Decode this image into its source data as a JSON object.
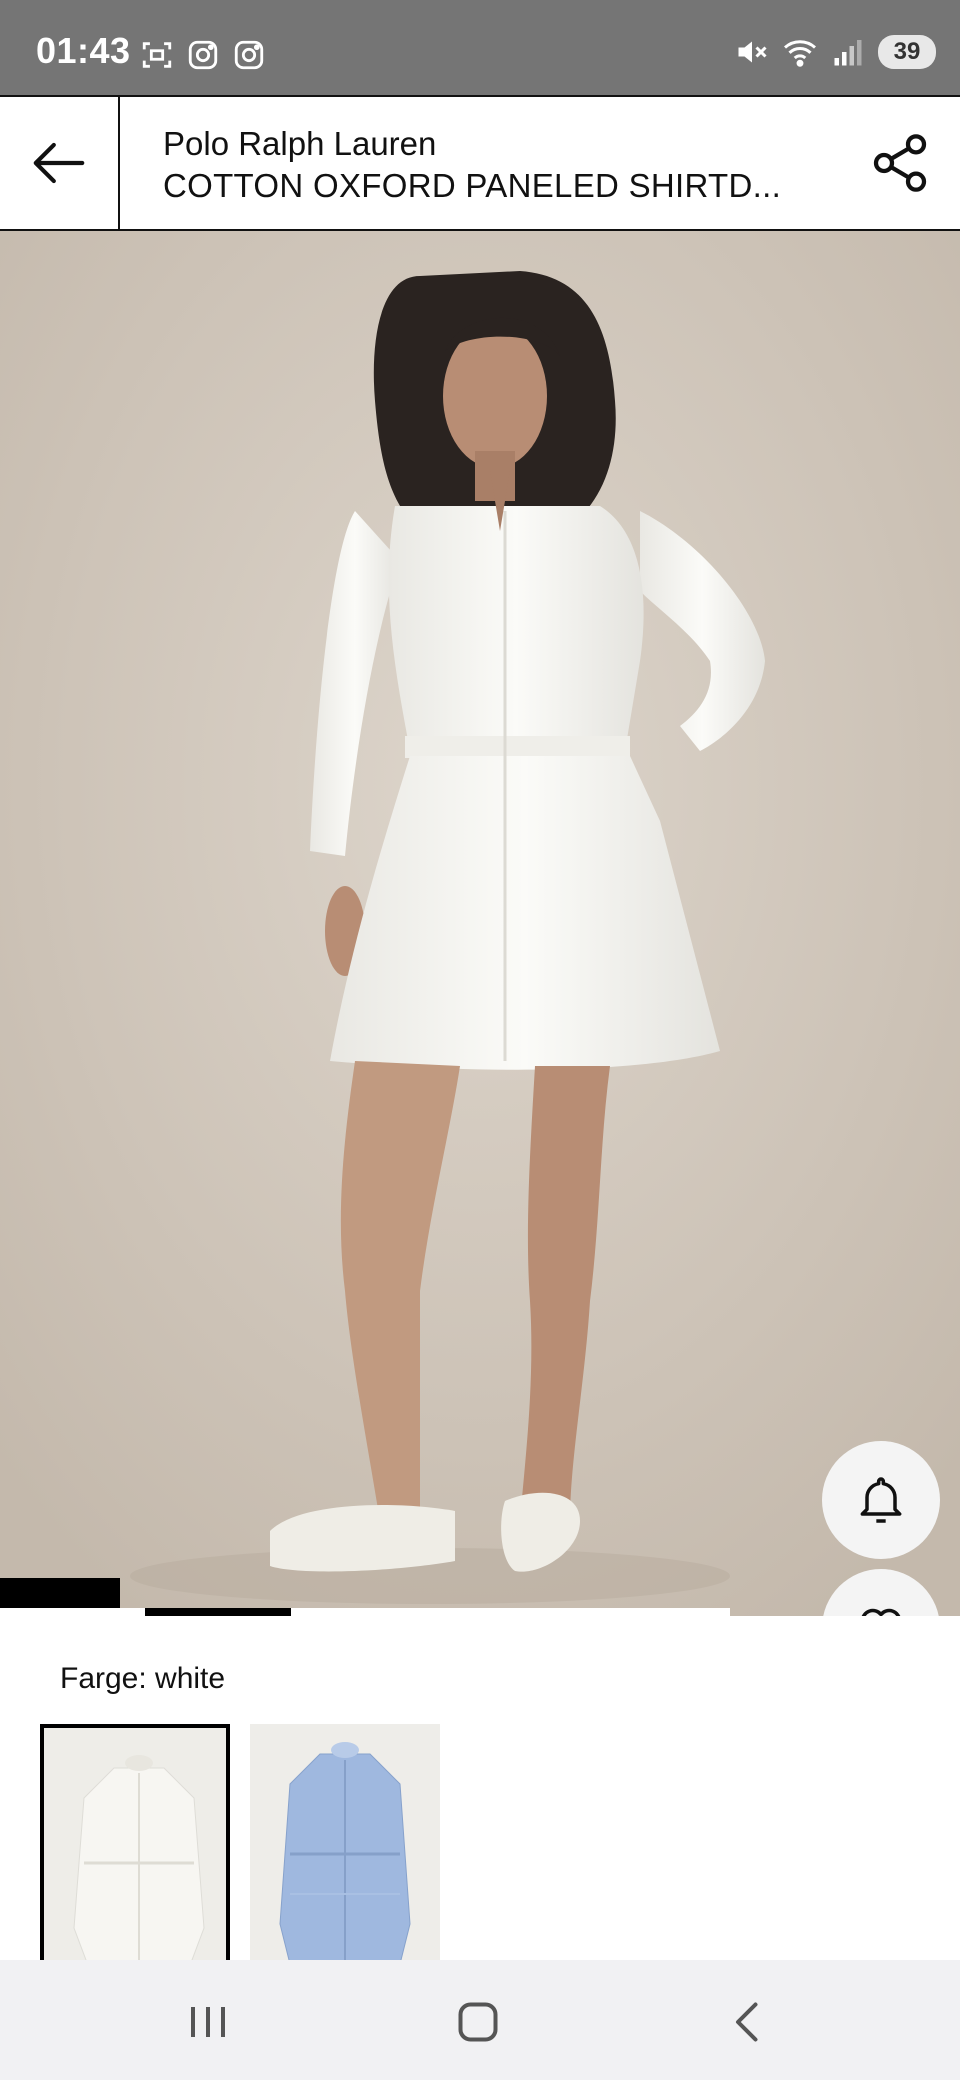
{
  "status_bar": {
    "time": "01:43",
    "battery": "39",
    "left_icons": [
      "screenshot-icon",
      "instagram-icon",
      "instagram-icon"
    ],
    "right_icons": [
      "mute-icon",
      "wifi-icon",
      "signal-icon"
    ]
  },
  "header": {
    "brand": "Polo Ralph Lauren",
    "product_title": "COTTON OXFORD PANELED SHIRTD...",
    "back_icon": "arrow-left-icon",
    "share_icon": "share-icon"
  },
  "gallery": {
    "image_subject": "model-in-white-shirtdress",
    "actions": [
      "bell-icon",
      "heart-icon",
      "shopping-bag-icon"
    ],
    "try_on_icon": "sparkle-tag-icon",
    "active_slide": 2,
    "slide_count": 5
  },
  "color_selector": {
    "label": "Farge: white",
    "options": [
      {
        "name": "white",
        "selected": true,
        "color": "#f7f6f2"
      },
      {
        "name": "blue",
        "selected": false,
        "color": "#9fb8df"
      }
    ]
  },
  "nav_bar": {
    "icons": [
      "recents-icon",
      "home-icon",
      "back-icon"
    ]
  },
  "colors": {
    "status_bar_bg": "#757575",
    "accent": "#000000",
    "nav_bg": "#f1f1f3"
  }
}
